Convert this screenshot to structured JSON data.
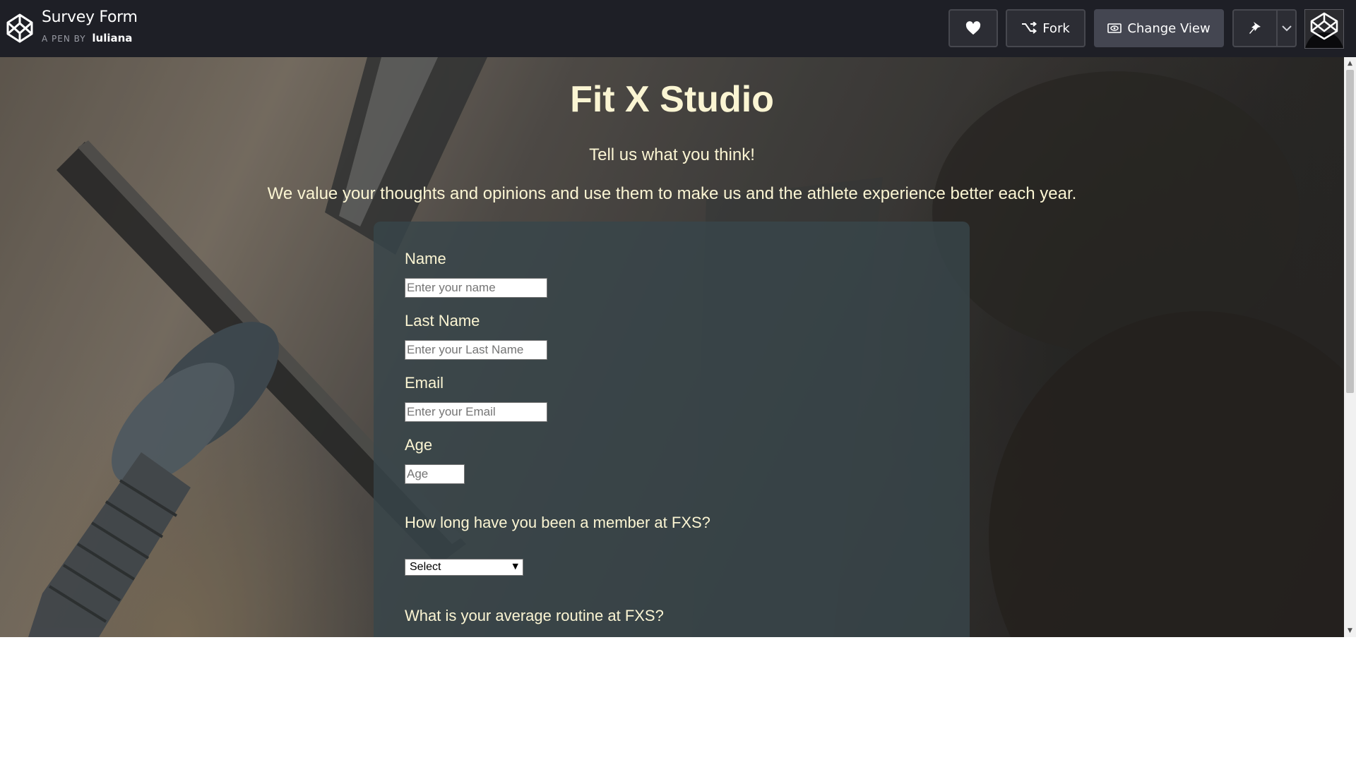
{
  "codepen": {
    "pen_title": "Survey Form",
    "pen_by_label": "A PEN BY",
    "author": "luliana",
    "buttons": {
      "fork_label": "Fork",
      "change_view_label": "Change View"
    },
    "icons": {
      "logo": "codepen-logo-icon",
      "heart": "heart-icon",
      "fork": "fork-icon",
      "change_view": "eye-icon",
      "pin": "pin-icon",
      "caret": "chevron-down-icon"
    }
  },
  "page": {
    "title": "Fit X Studio",
    "tagline": "Tell us what you think!",
    "description": "We value your thoughts and opinions and use them to make us and the athlete experience better each year."
  },
  "form": {
    "name": {
      "label": "Name",
      "placeholder": "Enter your name"
    },
    "last_name": {
      "label": "Last Name",
      "placeholder": "Enter your Last Name"
    },
    "email": {
      "label": "Email",
      "placeholder": "Enter your Email"
    },
    "age": {
      "label": "Age",
      "placeholder": "Age"
    },
    "membership": {
      "question": "How long have you been a member at FXS?",
      "selected": "Select"
    },
    "routine": {
      "question": "What is your average routine at FXS?"
    }
  },
  "colors": {
    "topbar": "#1e1f26",
    "heading_text": "#fbf5d3",
    "card": "#38464a"
  }
}
